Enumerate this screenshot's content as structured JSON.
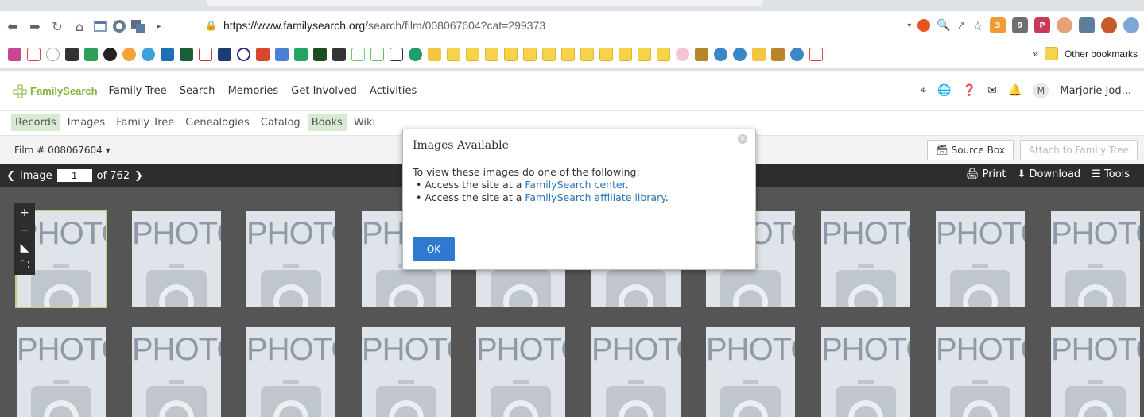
{
  "browser": {
    "url_host": "https://www.familysearch.org",
    "url_path": "/search/film/008067604?cat=299373",
    "other_bookmarks": "Other bookmarks",
    "bookmark_more": "»"
  },
  "header": {
    "logo": "FamilySearch",
    "nav": [
      "Family Tree",
      "Search",
      "Memories",
      "Get Involved",
      "Activities"
    ],
    "avatar_initial": "M",
    "user_name": "Marjorie Jod..."
  },
  "subnav": {
    "items": [
      "Records",
      "Images",
      "Family Tree",
      "Genealogies",
      "Catalog",
      "Books",
      "Wiki"
    ]
  },
  "filmbar": {
    "film_label": "Film # 008067604",
    "source_box": "Source Box",
    "attach": "Attach to Family Tree"
  },
  "viewer": {
    "image_label": "Image",
    "current": "1",
    "of_label": "of 762",
    "print": "Print",
    "download": "Download",
    "tools": "Tools",
    "thumb_label": "PHOTO"
  },
  "modal": {
    "title": "Images Available",
    "intro": "To view these images do one of the following:",
    "line1_prefix": "Access the site at a ",
    "line1_link": "FamilySearch center",
    "line1_suffix": ".",
    "line2_prefix": "Access the site at a ",
    "line2_link": "FamilySearch affiliate library",
    "line2_suffix": ".",
    "ok": "OK"
  }
}
